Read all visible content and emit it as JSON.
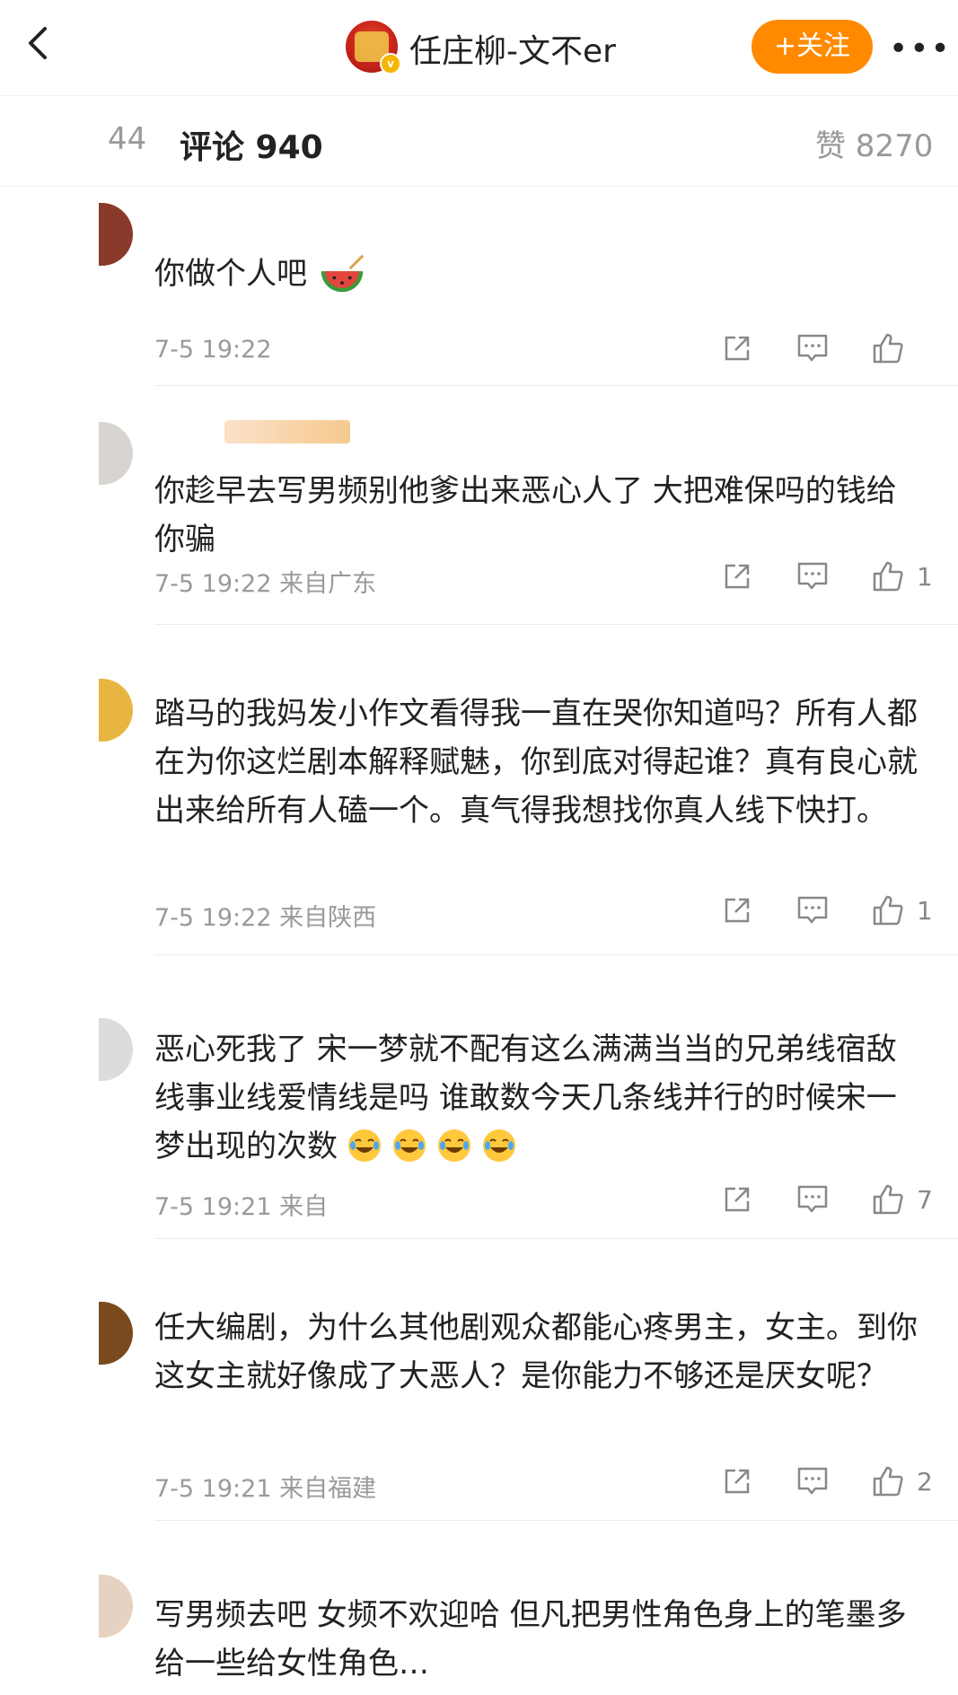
{
  "header": {
    "title": "任庄柳-文不er",
    "follow_label": "+关注",
    "more_label": "•••"
  },
  "tabs": {
    "repost_count": "44",
    "comments_label": "评论 940",
    "likes_label": "赞 8270"
  },
  "comments": [
    {
      "text": "你做个人吧",
      "meta": "7-5 19:22",
      "has_emoji": "watermelon",
      "like_count": ""
    },
    {
      "text": "你趁早去写男频别他爹出来恶心人了 大把难保吗的钱给你骗",
      "meta": "7-5 19:22  来自广东",
      "like_count": "1"
    },
    {
      "text": "踏马的我妈发小作文看得我一直在哭你知道吗？所有人都在为你这烂剧本解释赋魅，你到底对得起谁？真有良心就出来给所有人磕一个。真气得我想找你真人线下快打。",
      "meta": "7-5 19:22  来自陕西",
      "like_count": "1"
    },
    {
      "text": "恶心死我了 宋一梦就不配有这么满满当当的兄弟线宿敌线事业线爱情线是吗 谁敢数今天几条线并行的时候宋一梦出现的次数",
      "meta": "7-5 19:21  来自",
      "emoji_count": 4,
      "like_count": "7"
    },
    {
      "text": "任大编剧，为什么其他剧观众都能心疼男主，女主。到你这女主就好像成了大恶人？是你能力不够还是厌女呢？",
      "meta": "7-5 19:21  来自福建",
      "like_count": "2"
    },
    {
      "text": "写男频去吧 女频不欢迎哈 但凡把男性角色身上的笔墨多给一些给女性角色…",
      "meta": "",
      "like_count": ""
    }
  ],
  "colors": {
    "accent_orange": "#ff8a00",
    "meta_gray": "#9a9a9a",
    "name_orange": "#e07a00"
  },
  "icons": {
    "back": "chevron-left-icon",
    "share": "share-icon",
    "comment": "comment-icon",
    "like": "thumbs-up-icon",
    "emoji_laugh": "laughing-tears-emoji-icon",
    "emoji_watermelon": "watermelon-emoji-icon"
  }
}
